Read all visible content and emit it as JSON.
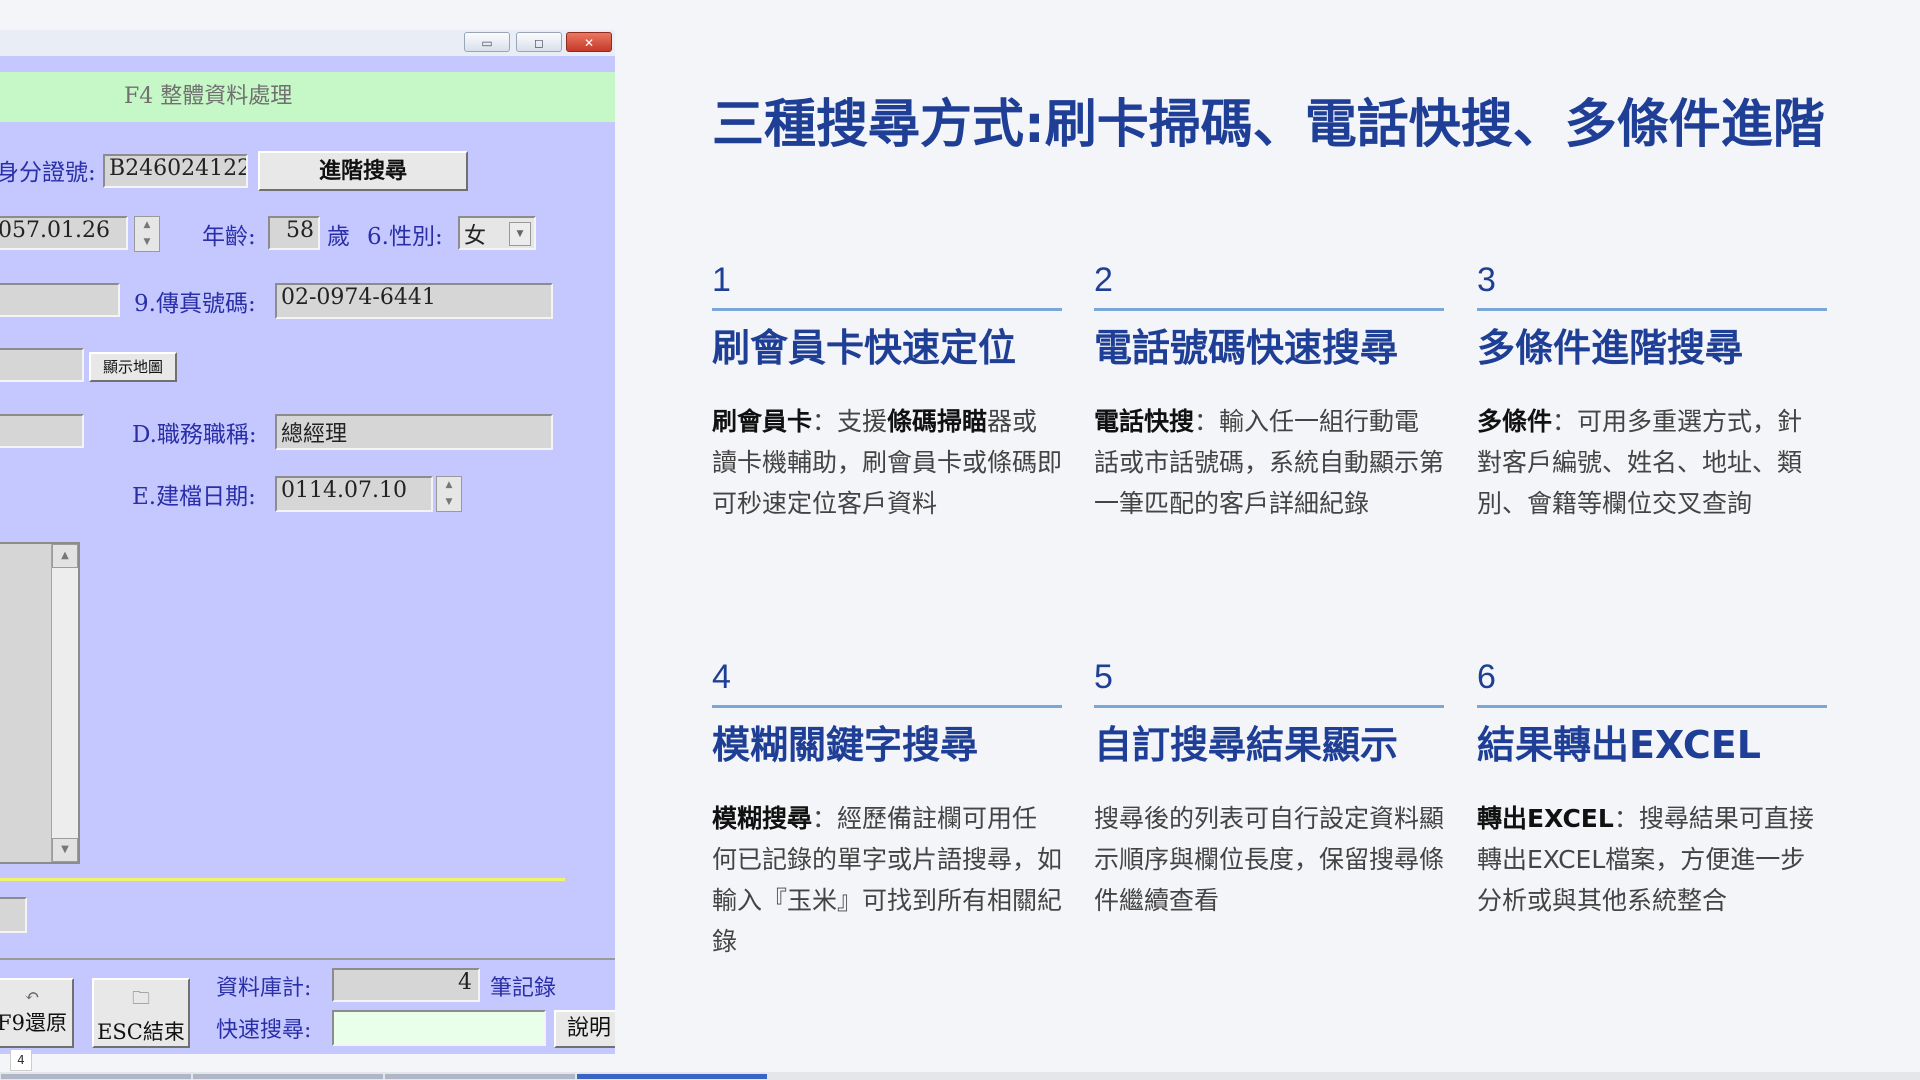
{
  "window": {
    "minimize_glyph": "▭",
    "maximize_glyph": "◻",
    "close_glyph": "✕",
    "form_title": "F4 整體資料處理"
  },
  "form": {
    "id_label": "身分證號:",
    "id_value": "B246024122",
    "advanced_search_button": "進階搜尋",
    "birth_value": "057.01.26",
    "age_label": "年齡:",
    "age_value": "58",
    "age_unit": "歲",
    "gender_label": "6.性別:",
    "gender_value": "女",
    "fax_label": "9.傳真號碼:",
    "fax_value": "02-0974-6441",
    "show_map_button": "顯示地圖",
    "title_label": "D.職務職稱:",
    "title_value": "總經理",
    "created_label": "E.建檔日期:",
    "created_value": "0114.07.10"
  },
  "bottom": {
    "restore_button": "F9還原",
    "esc_button": "ESC結束",
    "records_label": "資料庫計:",
    "records_value": "4",
    "records_unit": "筆記錄",
    "quick_search_label": "快速搜尋:",
    "quick_search_value": "",
    "help_button": "說明"
  },
  "page_badge": "4",
  "progress": {
    "segments": 10,
    "active_index": 3
  },
  "slide": {
    "title": "三種搜尋方式:刷卡掃碼、電話快搜、多條件進階",
    "cards": [
      {
        "num": "1",
        "heading": "刷會員卡快速定位",
        "desc_bold": "刷會員卡",
        "desc_parts": [
          "：支援",
          "條碼掃瞄",
          "器或讀卡機輔助，刷會員卡或條碼即可秒速定位客戶資料"
        ]
      },
      {
        "num": "2",
        "heading": "電話號碼快速搜尋",
        "desc_bold": "電話快搜",
        "desc_rest": "：輸入任一組行動電話或市話號碼，系統自動顯示第一筆匹配的客戶詳細紀錄"
      },
      {
        "num": "3",
        "heading": "多條件進階搜尋",
        "desc_bold": "多條件",
        "desc_rest": "：可用多重選方式，針對客戶編號、姓名、地址、類別、會籍等欄位交叉查詢"
      },
      {
        "num": "4",
        "heading": "模糊關鍵字搜尋",
        "desc_bold": "模糊搜尋",
        "desc_rest": "：經歷備註欄可用任何已記錄的單字或片語搜尋，如輸入『玉米』可找到所有相關紀錄"
      },
      {
        "num": "5",
        "heading": "自訂搜尋結果顯示",
        "desc_bold": "",
        "desc_rest": "搜尋後的列表可自行設定資料顯示順序與欄位長度，保留搜尋條件繼續查看"
      },
      {
        "num": "6",
        "heading": "結果轉出EXCEL",
        "desc_bold": "轉出EXCEL",
        "desc_rest": "：搜尋結果可直接轉出EXCEL檔案，方便進一步分析或與其他系統整合"
      }
    ]
  }
}
